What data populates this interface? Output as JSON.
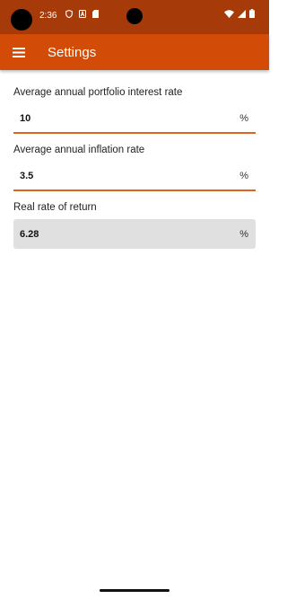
{
  "status_bar": {
    "time": "2:36",
    "icons": [
      "shield-icon",
      "a-icon",
      "sd-card-icon",
      "wifi-icon",
      "signal-icon",
      "battery-icon"
    ]
  },
  "app_bar": {
    "title": "Settings",
    "menu_icon": "hamburger-menu-icon"
  },
  "fields": {
    "interest": {
      "label": "Average annual portfolio interest rate",
      "value": "10",
      "suffix": "%"
    },
    "inflation": {
      "label": "Average annual inflation rate",
      "value": "3.5",
      "suffix": "%"
    },
    "real_return": {
      "label": "Real rate of return",
      "value": "6.28",
      "suffix": "%"
    }
  },
  "colors": {
    "status_bar": "#a63a08",
    "app_bar": "#d24c07",
    "accent_underline": "#e0631e",
    "readonly_bg": "#e0e0e0"
  }
}
